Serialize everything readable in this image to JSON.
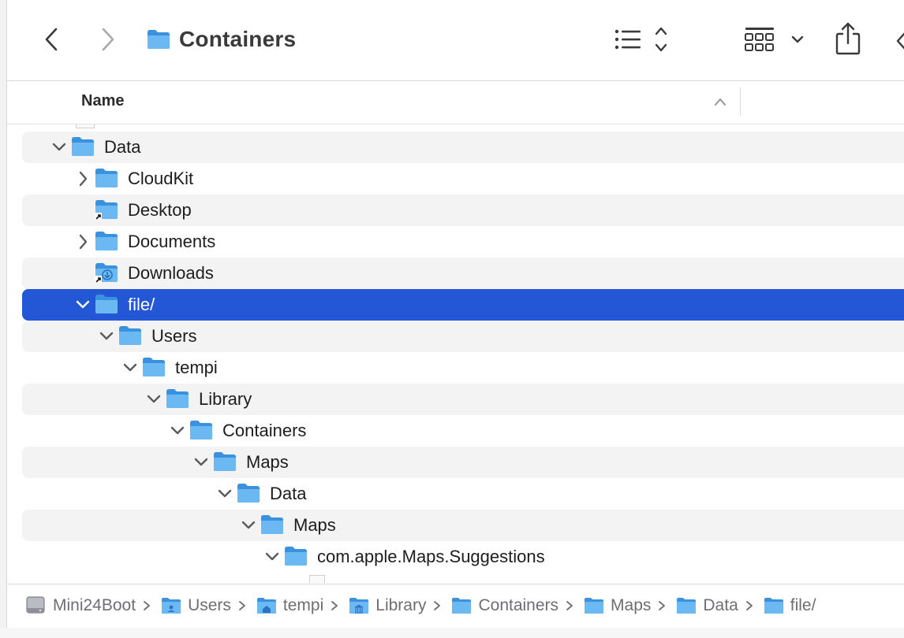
{
  "window": {
    "title": "Containers"
  },
  "toolbar": {
    "back_icon": "chevron-left-icon",
    "forward_icon": "chevron-right-icon",
    "view_list_icon": "list-view-icon",
    "view_grid_icon": "grid-view-icon",
    "share_icon": "share-icon"
  },
  "column_header": {
    "name_label": "Name",
    "sort": "ascending"
  },
  "tree": [
    {
      "label": "Data",
      "level": 0,
      "expanded": true,
      "icon": "folder-icon"
    },
    {
      "label": "CloudKit",
      "level": 1,
      "expanded": false,
      "icon": "folder-icon"
    },
    {
      "label": "Desktop",
      "level": 1,
      "icon": "folder-alias-icon"
    },
    {
      "label": "Documents",
      "level": 1,
      "expanded": false,
      "icon": "folder-icon"
    },
    {
      "label": "Downloads",
      "level": 1,
      "icon": "downloads-folder-alias-icon"
    },
    {
      "label": "file/",
      "level": 1,
      "expanded": true,
      "selected": true,
      "icon": "folder-icon"
    },
    {
      "label": "Users",
      "level": 2,
      "expanded": true,
      "icon": "folder-icon"
    },
    {
      "label": "tempi",
      "level": 3,
      "expanded": true,
      "icon": "folder-icon"
    },
    {
      "label": "Library",
      "level": 4,
      "expanded": true,
      "icon": "folder-icon"
    },
    {
      "label": "Containers",
      "level": 5,
      "expanded": true,
      "icon": "folder-icon"
    },
    {
      "label": "Maps",
      "level": 6,
      "expanded": true,
      "icon": "folder-icon"
    },
    {
      "label": "Data",
      "level": 7,
      "expanded": true,
      "icon": "folder-icon"
    },
    {
      "label": "Maps",
      "level": 8,
      "expanded": true,
      "icon": "folder-icon"
    },
    {
      "label": "com.apple.Maps.Suggestions",
      "level": 9,
      "expanded": true,
      "icon": "folder-icon"
    }
  ],
  "path_bar": [
    {
      "label": "Mini24Boot",
      "icon": "hard-drive-icon"
    },
    {
      "label": "Users",
      "icon": "users-folder-icon"
    },
    {
      "label": "tempi",
      "icon": "home-folder-icon"
    },
    {
      "label": "Library",
      "icon": "library-folder-icon"
    },
    {
      "label": "Containers",
      "icon": "folder-icon"
    },
    {
      "label": "Maps",
      "icon": "folder-icon"
    },
    {
      "label": "Data",
      "icon": "folder-icon"
    },
    {
      "label": "file/",
      "icon": "folder-icon"
    }
  ],
  "colors": {
    "selection": "#2357d6",
    "folder": "#5aaef0",
    "folder_dark": "#3a92de"
  }
}
